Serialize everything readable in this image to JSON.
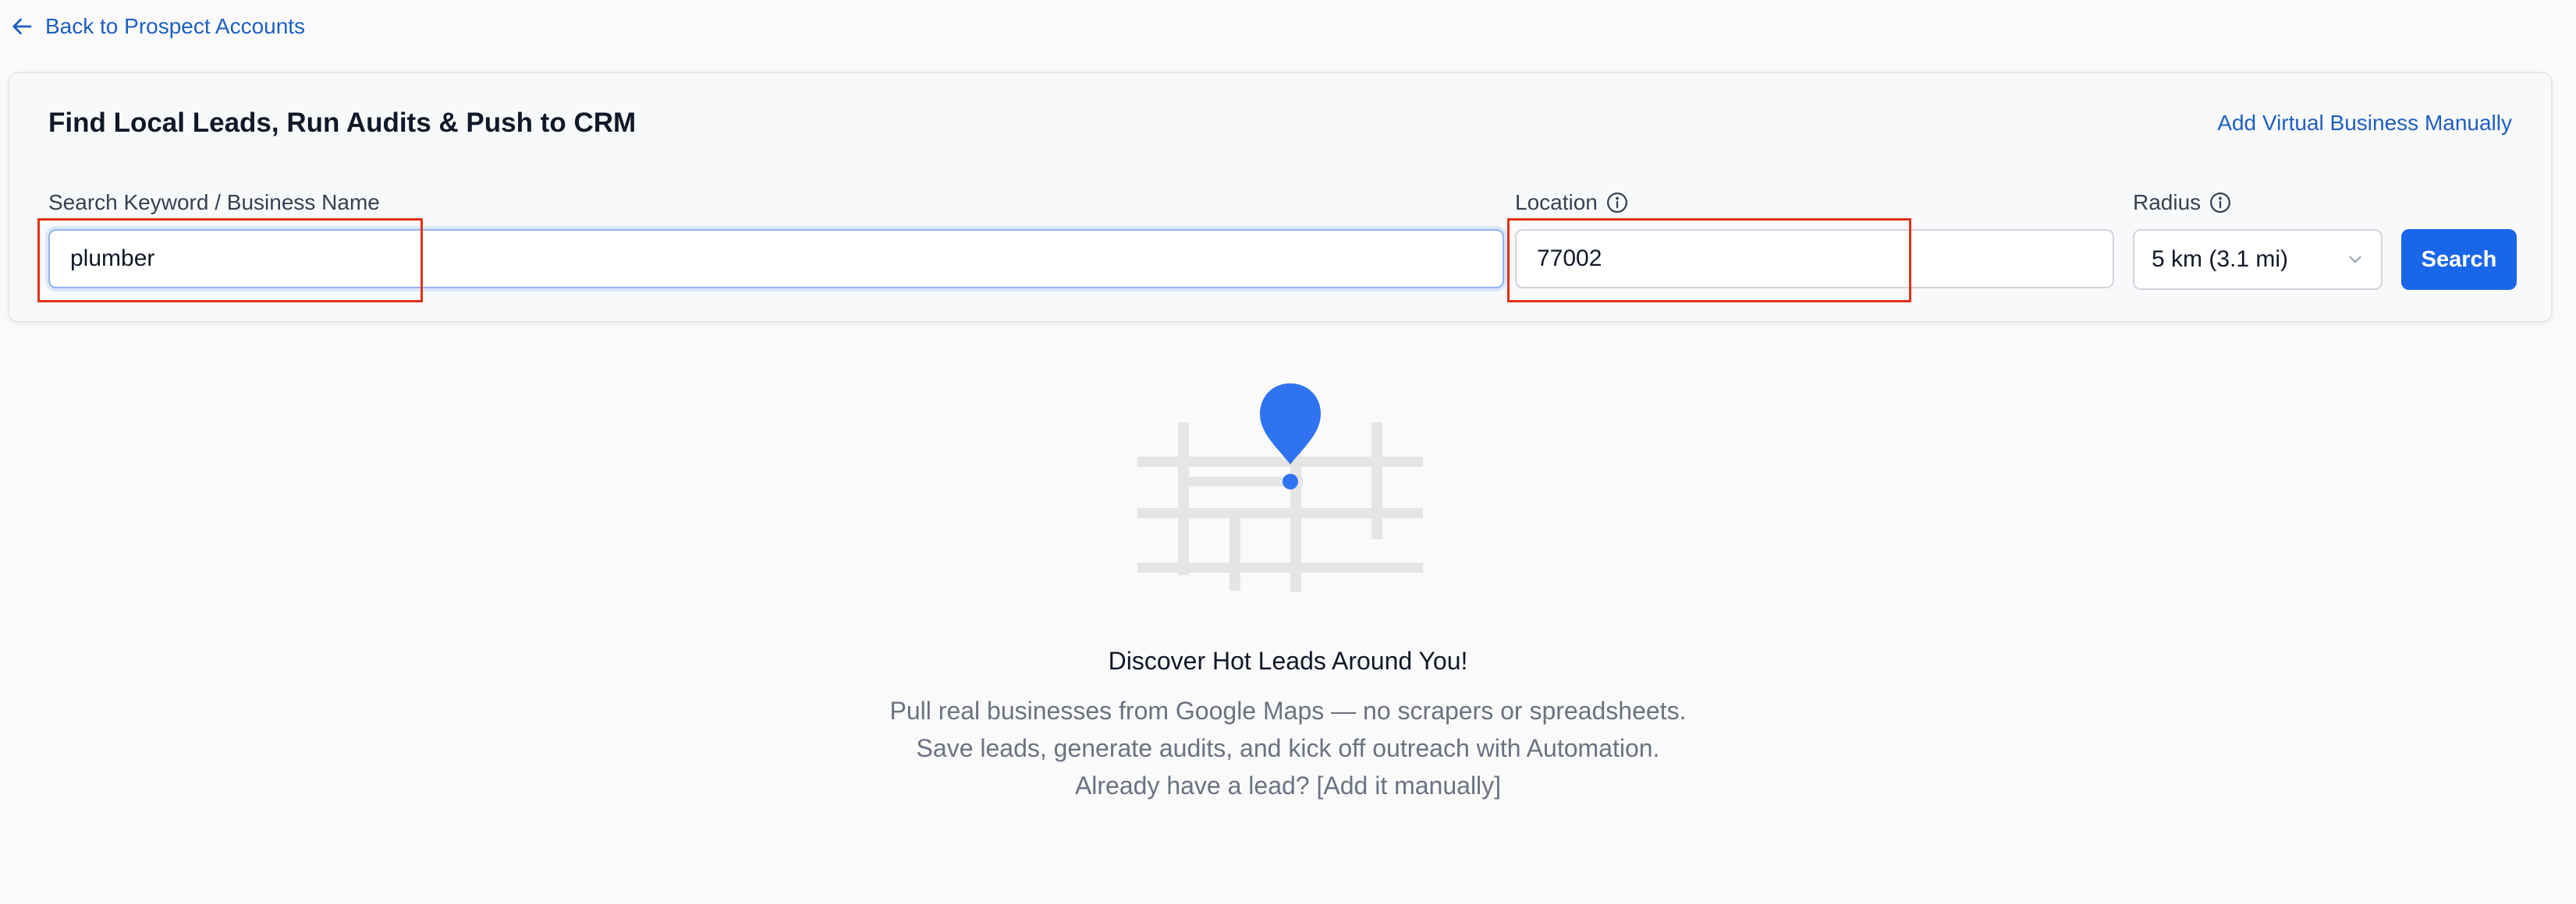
{
  "nav": {
    "back_label": "Back to Prospect Accounts"
  },
  "card": {
    "title": "Find Local Leads, Run Audits & Push to CRM",
    "add_manual_label": "Add Virtual Business Manually",
    "keyword": {
      "label": "Search Keyword / Business Name",
      "value": "plumber"
    },
    "location": {
      "label": "Location",
      "value": "77002"
    },
    "radius": {
      "label": "Radius",
      "selected": "5 km (3.1 mi)"
    },
    "search_label": "Search"
  },
  "empty_state": {
    "title": "Discover Hot Leads Around You!",
    "line1": "Pull real businesses from Google Maps — no scrapers or spreadsheets.",
    "line2": "Save leads, generate audits, and kick off outreach with Automation.",
    "line3": "Already have a lead? [Add it manually]"
  },
  "colors": {
    "accent": "#1a66e8",
    "link": "#1f5fbf",
    "highlight": "#e1311a",
    "map_lines": "#e5e5e5"
  },
  "icons": [
    "arrow-left-icon",
    "info-icon",
    "chevron-down-icon",
    "map-pin-icon"
  ]
}
